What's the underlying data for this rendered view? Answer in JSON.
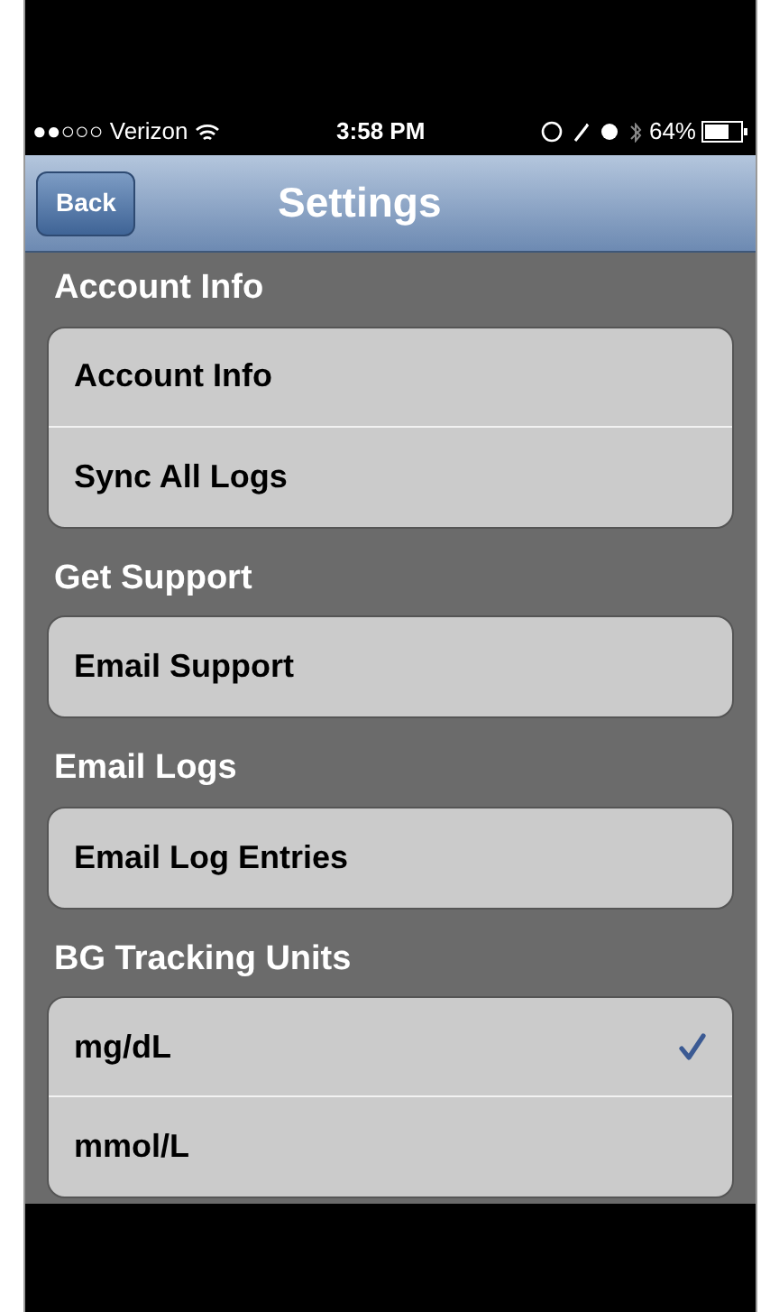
{
  "status_bar": {
    "carrier": "●●○○○ Verizon",
    "time": "3:58 PM",
    "battery": "64%"
  },
  "nav_bar": {
    "back": "Back",
    "title": "Settings"
  },
  "sections": [
    {
      "header": "Account Info",
      "items": [
        {
          "label": "Account Info",
          "kind": "action"
        },
        {
          "label": "Sync All Logs",
          "kind": "action"
        }
      ]
    },
    {
      "header": "Get Support",
      "items": [
        {
          "label": "Email Support",
          "kind": "action"
        }
      ]
    },
    {
      "header": "Email Logs",
      "items": [
        {
          "label": "Email Log Entries",
          "kind": "action"
        }
      ]
    },
    {
      "header": "BG Tracking Units",
      "items": [
        {
          "label": "mg/dL",
          "kind": "option",
          "checked": true
        },
        {
          "label": "mmol/L",
          "kind": "option",
          "checked": false
        }
      ]
    }
  ]
}
